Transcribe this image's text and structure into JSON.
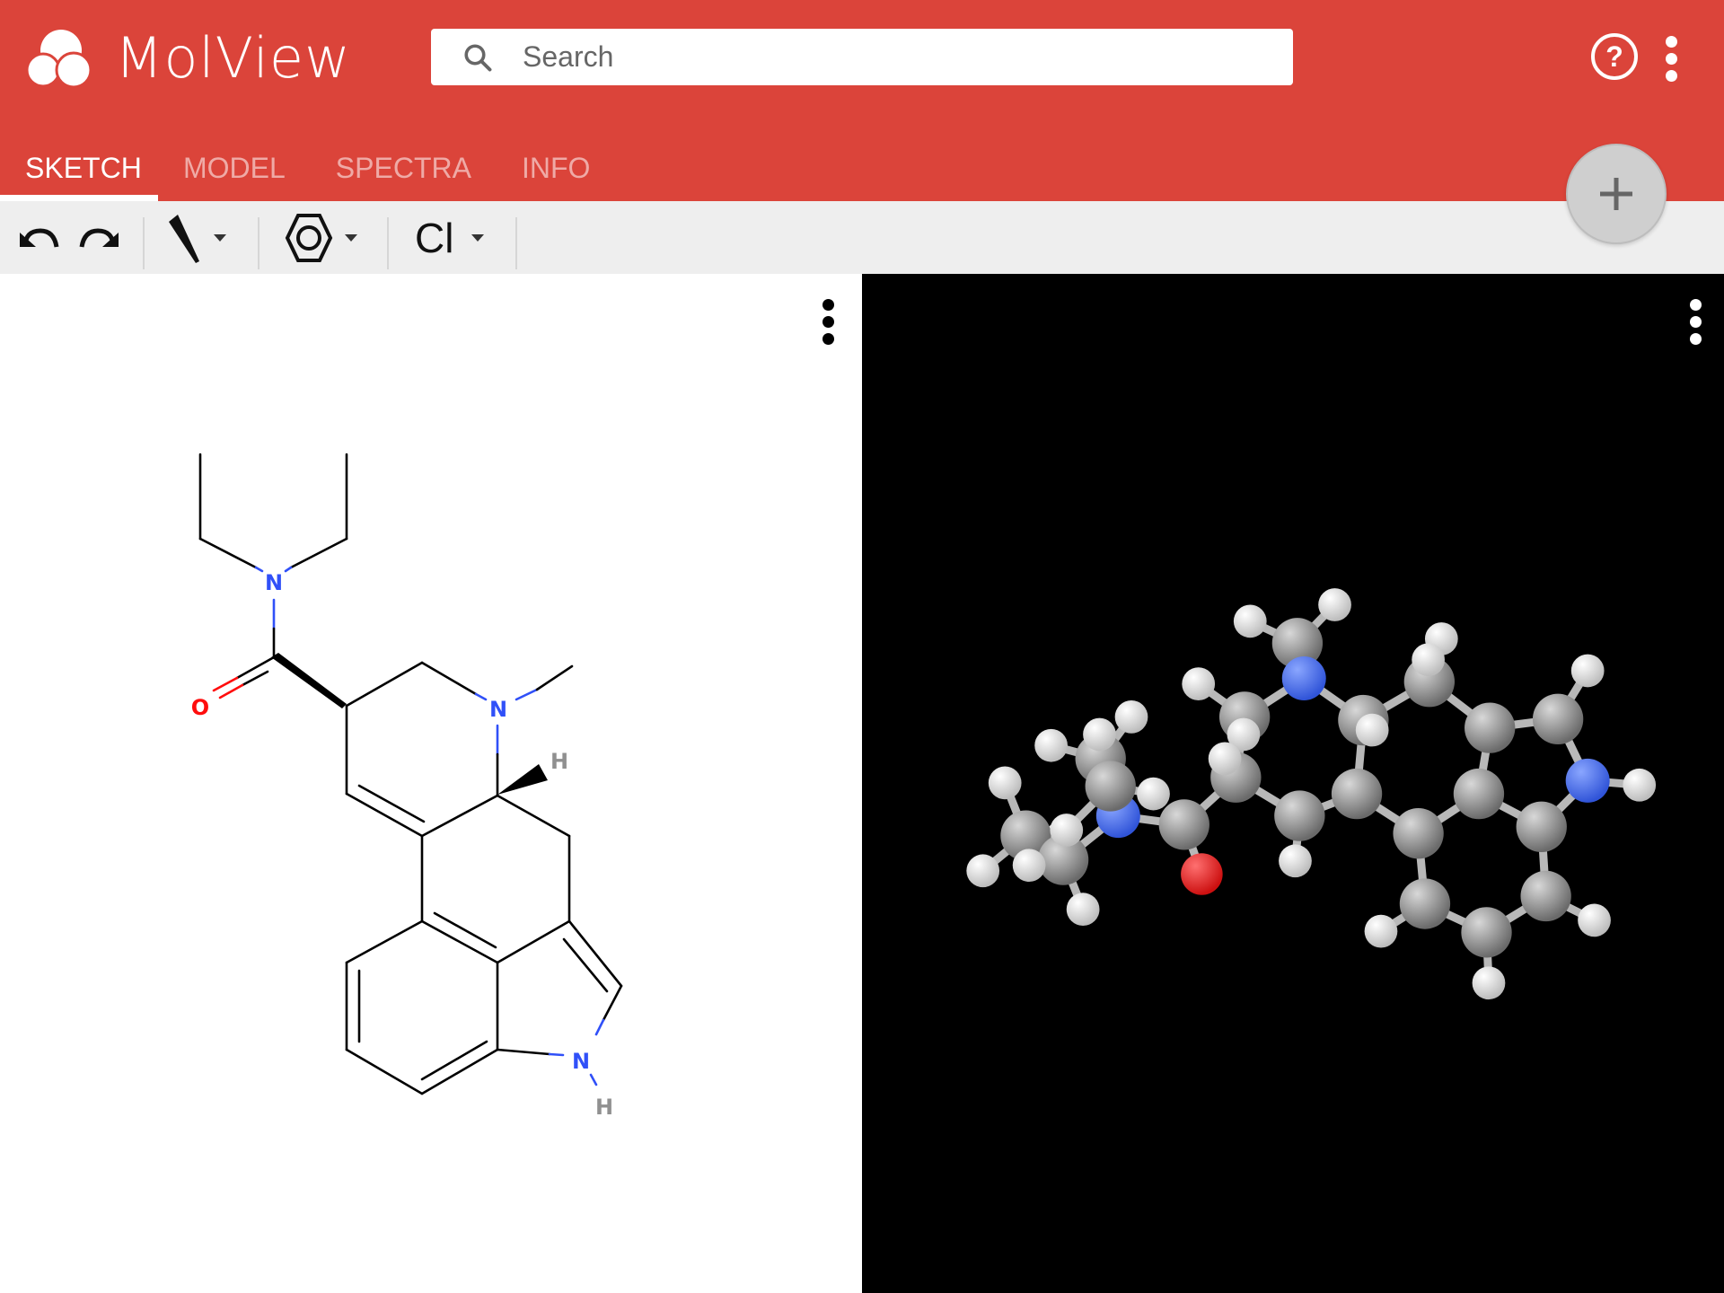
{
  "app": {
    "name": "MolView",
    "brand_color": "#db443a"
  },
  "search": {
    "placeholder": "Search",
    "value": ""
  },
  "header_actions": {
    "help_icon": "help-circle-icon",
    "menu_icon": "more-vert-icon"
  },
  "tabs": [
    {
      "label": "SKETCH",
      "active": true
    },
    {
      "label": "MODEL",
      "active": false
    },
    {
      "label": "SPECTRA",
      "active": false
    },
    {
      "label": "INFO",
      "active": false
    }
  ],
  "fab": {
    "icon": "plus-icon"
  },
  "toolbar": {
    "undo_icon": "undo-icon",
    "redo_icon": "redo-icon",
    "bond_tool_icon": "wedge-bond-icon",
    "ring_tool_icon": "benzene-ring-icon",
    "element_label": "Cl"
  },
  "sketch": {
    "atom_labels": {
      "N_amide": "N",
      "O": "O",
      "N_ring": "N",
      "H_stereo": "H",
      "N_indole": "N",
      "H_indole": "H"
    },
    "colors": {
      "N": "#3050f8",
      "O": "#ff0d0d",
      "H": "#909090",
      "bond": "#000000"
    }
  },
  "model": {
    "colors": {
      "C": "#909090",
      "N": "#4a70f0",
      "O": "#ee2020",
      "H": "#f0f0f0",
      "background": "#000000"
    }
  }
}
